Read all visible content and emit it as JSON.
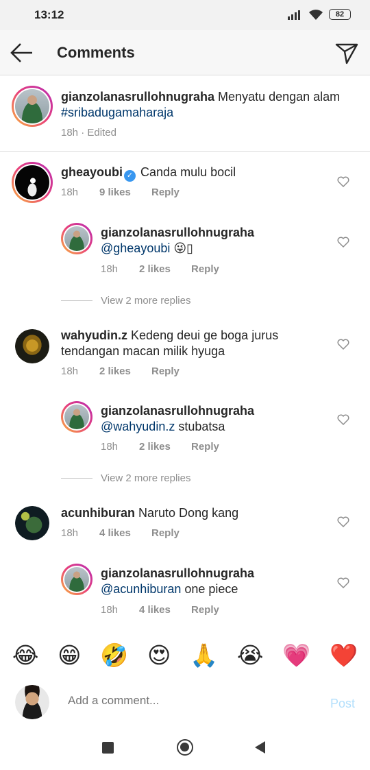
{
  "status_bar": {
    "time": "13:12",
    "battery": "82",
    "icons": [
      "signal-icon",
      "wifi-icon",
      "battery-icon"
    ]
  },
  "header": {
    "title": "Comments",
    "back_icon": "arrow-left-icon",
    "send_icon": "paper-plane-icon"
  },
  "caption": {
    "username": "gianzolanasrullohnugraha",
    "text": "Menyatu dengan alam",
    "hashtag": "#sribadugamaharaja",
    "time": "18h",
    "edited": "Edited"
  },
  "comments": [
    {
      "username": "gheayoubi",
      "verified": true,
      "text": "Canda mulu bocil",
      "time": "18h",
      "likes": "9 likes",
      "reply": "Reply",
      "reply_item": {
        "username": "gianzolanasrullohnugraha",
        "mention": "@gheayoubi",
        "text": "😜▯",
        "time": "18h",
        "likes": "2 likes",
        "reply": "Reply"
      },
      "more_replies": "View 2 more replies"
    },
    {
      "username": "wahyudin.z",
      "text": "Kedeng deui ge boga jurus tendangan macan milik hyuga",
      "time": "18h",
      "likes": "2 likes",
      "reply": "Reply",
      "reply_item": {
        "username": "gianzolanasrullohnugraha",
        "mention": "@wahyudin.z",
        "text": "stubatsa",
        "time": "18h",
        "likes": "2 likes",
        "reply": "Reply"
      },
      "more_replies": "View 2 more replies"
    },
    {
      "username": "acunhiburan",
      "text": "Naruto Dong kang",
      "time": "18h",
      "likes": "4 likes",
      "reply": "Reply",
      "reply_item": {
        "username": "gianzolanasrullohnugraha",
        "mention": "@acunhiburan",
        "text": "one piece",
        "time": "18h",
        "likes": "4 likes",
        "reply": "Reply"
      }
    }
  ],
  "emoji_bar": [
    "😂",
    "😁",
    "🤣",
    "😍",
    "🙏",
    "😭",
    "💗",
    "❤️"
  ],
  "composer": {
    "placeholder": "Add a comment...",
    "post_label": "Post"
  },
  "colors": {
    "link": "#00376b",
    "verified": "#3897f0",
    "post_disabled": "#b2dffc",
    "meta": "#8e8e8e"
  }
}
